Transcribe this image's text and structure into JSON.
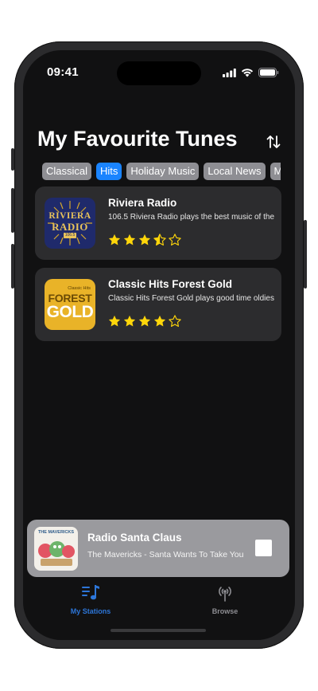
{
  "status_bar": {
    "time": "09:41"
  },
  "header": {
    "title": "My Favourite Tunes"
  },
  "filters": [
    {
      "label": "Classical",
      "active": false
    },
    {
      "label": "Hits",
      "active": true
    },
    {
      "label": "Holiday Music",
      "active": false
    },
    {
      "label": "Local News",
      "active": false
    },
    {
      "label": "Mu",
      "active": false
    }
  ],
  "stations": [
    {
      "name": "Riviera Radio",
      "description": "106.5 Riviera Radio plays the best music of the",
      "rating": 3.5,
      "logo": {
        "line1": "RIVIERA",
        "line2": "RADIO",
        "badge": "106.5"
      }
    },
    {
      "name": "Classic Hits Forest Gold",
      "description": "Classic Hits Forest Gold plays good time oldies",
      "rating": 4,
      "logo": {
        "small": "Classic Hits",
        "line1": "FOREST",
        "line2": "GOLD"
      }
    }
  ],
  "now_playing": {
    "station": "Radio Santa Claus",
    "track": "The Mavericks - Santa Wants To Take You",
    "art_text": "THE MAVERICKS"
  },
  "tabs": [
    {
      "label": "My Stations",
      "active": true,
      "icon": "music-list-icon"
    },
    {
      "label": "Browse",
      "active": false,
      "icon": "broadcast-icon"
    }
  ],
  "colors": {
    "accent": "#1a84ff",
    "star": "#ffd60a",
    "tab_active": "#2d76d9"
  }
}
